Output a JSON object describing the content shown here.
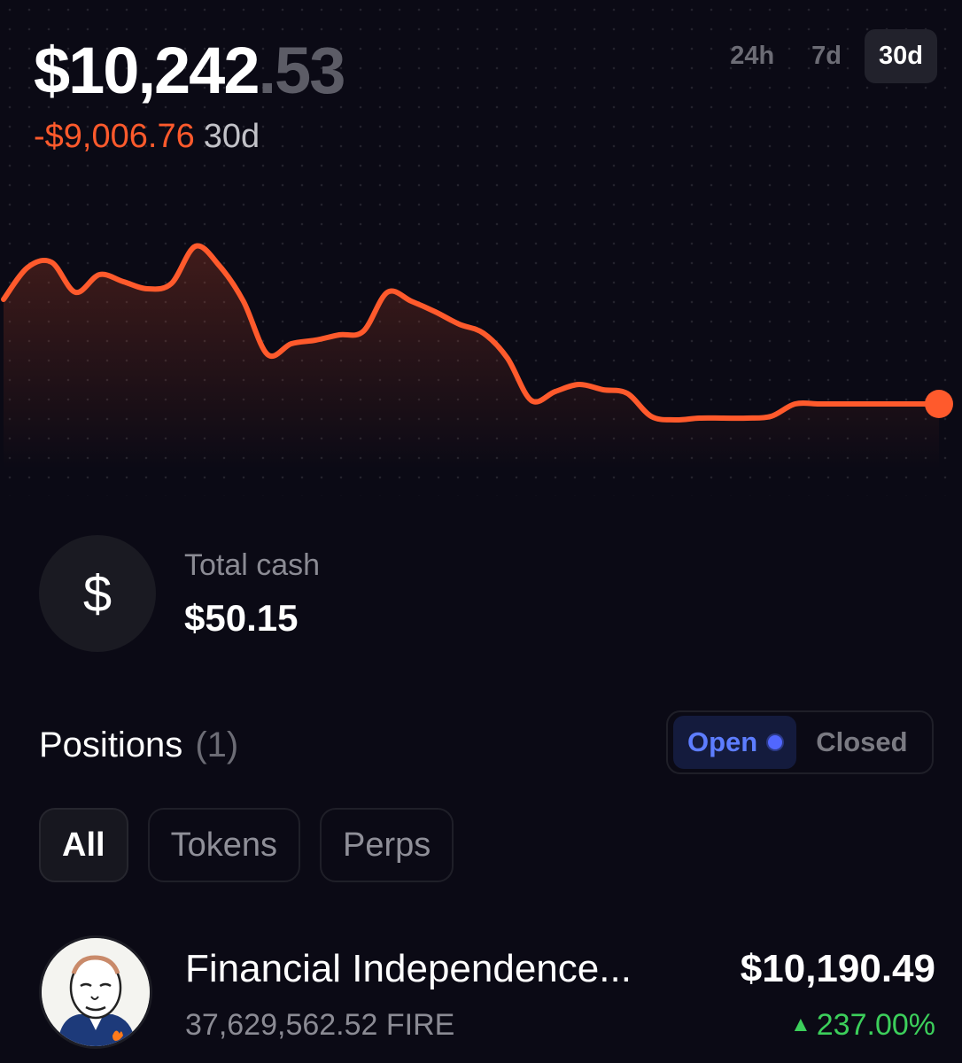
{
  "header": {
    "balance_whole": "$10,242",
    "balance_cents": ".53",
    "change_amount": "-$9,006.76",
    "change_period": "30d"
  },
  "timeframes": [
    {
      "label": "24h",
      "active": false
    },
    {
      "label": "7d",
      "active": false
    },
    {
      "label": "30d",
      "active": true
    }
  ],
  "colors": {
    "accent": "#ff5a2c",
    "positive": "#3ccf5b",
    "open_tab": "#5d7dff",
    "background": "#0b0a15"
  },
  "chart_data": {
    "type": "line",
    "x": [
      0,
      1,
      2,
      3,
      4,
      5,
      6,
      7,
      8,
      9,
      10,
      11,
      12,
      13,
      14,
      15,
      16,
      17,
      18,
      19,
      20,
      21,
      22,
      23,
      24,
      25,
      26,
      27,
      28,
      29,
      30,
      31,
      32,
      33,
      34,
      35,
      36,
      37,
      38,
      39
    ],
    "series": [
      {
        "values": [
          338,
          302,
          296,
          330,
          310,
          318,
          326,
          320,
          278,
          300,
          340,
          400,
          388,
          384,
          378,
          374,
          330,
          340,
          352,
          366,
          376,
          404,
          452,
          442,
          434,
          440,
          444,
          470,
          474,
          472,
          472,
          472,
          470,
          456,
          456,
          456,
          456,
          456,
          456,
          456
        ]
      }
    ],
    "last_point_marker": true
  },
  "cash": {
    "icon": "dollar-icon",
    "label": "Total cash",
    "value": "$50.15"
  },
  "positions": {
    "title": "Positions",
    "count": "(1)",
    "toggle": {
      "open": "Open",
      "closed": "Closed"
    },
    "filters": [
      "All",
      "Tokens",
      "Perps"
    ],
    "items": [
      {
        "name": "Financial Independence...",
        "amount": "37,629,562.52 FIRE",
        "value": "$10,190.49",
        "change": "237.00%",
        "change_icon": "triangle-up-icon"
      }
    ]
  }
}
